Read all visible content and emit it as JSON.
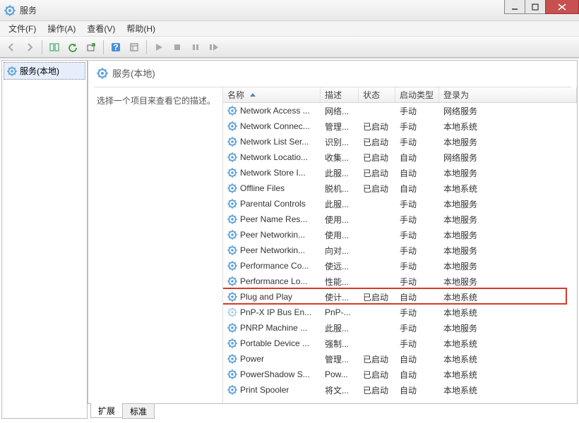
{
  "window": {
    "title": "服务"
  },
  "menu": {
    "file": "文件(F)",
    "action": "操作(A)",
    "view": "查看(V)",
    "help": "帮助(H)"
  },
  "tree": {
    "root_label": "服务(本地)"
  },
  "detail": {
    "header": "服务(本地)",
    "desc_prompt": "选择一个项目来查看它的描述。"
  },
  "columns": {
    "name": "名称",
    "desc": "描述",
    "status": "状态",
    "start": "启动类型",
    "logon": "登录为"
  },
  "tabs": {
    "extended": "扩展",
    "standard": "标准"
  },
  "services": [
    {
      "name": "Network Access ...",
      "desc": "网络...",
      "status": "",
      "start": "手动",
      "logon": "网络服务",
      "dim": false
    },
    {
      "name": "Network Connec...",
      "desc": "管理...",
      "status": "已启动",
      "start": "手动",
      "logon": "本地系统",
      "dim": false
    },
    {
      "name": "Network List Ser...",
      "desc": "识别...",
      "status": "已启动",
      "start": "手动",
      "logon": "本地服务",
      "dim": false
    },
    {
      "name": "Network Locatio...",
      "desc": "收集...",
      "status": "已启动",
      "start": "自动",
      "logon": "网络服务",
      "dim": false
    },
    {
      "name": "Network Store I...",
      "desc": "此服...",
      "status": "已启动",
      "start": "自动",
      "logon": "本地服务",
      "dim": false
    },
    {
      "name": "Offline Files",
      "desc": "脱机...",
      "status": "已启动",
      "start": "自动",
      "logon": "本地系统",
      "dim": false
    },
    {
      "name": "Parental Controls",
      "desc": "此服...",
      "status": "",
      "start": "手动",
      "logon": "本地服务",
      "dim": false
    },
    {
      "name": "Peer Name Res...",
      "desc": "使用...",
      "status": "",
      "start": "手动",
      "logon": "本地服务",
      "dim": false
    },
    {
      "name": "Peer Networkin...",
      "desc": "使用...",
      "status": "",
      "start": "手动",
      "logon": "本地服务",
      "dim": false
    },
    {
      "name": "Peer Networkin...",
      "desc": "向对...",
      "status": "",
      "start": "手动",
      "logon": "本地服务",
      "dim": false
    },
    {
      "name": "Performance Co...",
      "desc": "使远...",
      "status": "",
      "start": "手动",
      "logon": "本地服务",
      "dim": false
    },
    {
      "name": "Performance Lo...",
      "desc": "性能...",
      "status": "",
      "start": "手动",
      "logon": "本地服务",
      "dim": false
    },
    {
      "name": "Plug and Play",
      "desc": "使计...",
      "status": "已启动",
      "start": "自动",
      "logon": "本地系统",
      "dim": false,
      "highlight": true
    },
    {
      "name": "PnP-X IP Bus En...",
      "desc": "PnP-...",
      "status": "",
      "start": "手动",
      "logon": "本地系统",
      "dim": true
    },
    {
      "name": "PNRP Machine ...",
      "desc": "此服...",
      "status": "",
      "start": "手动",
      "logon": "本地服务",
      "dim": false
    },
    {
      "name": "Portable Device ...",
      "desc": "强制...",
      "status": "",
      "start": "手动",
      "logon": "本地系统",
      "dim": false
    },
    {
      "name": "Power",
      "desc": "管理...",
      "status": "已启动",
      "start": "自动",
      "logon": "本地系统",
      "dim": false
    },
    {
      "name": "PowerShadow S...",
      "desc": "Pow...",
      "status": "已启动",
      "start": "自动",
      "logon": "本地系统",
      "dim": false
    },
    {
      "name": "Print Spooler",
      "desc": "将文...",
      "status": "已启动",
      "start": "自动",
      "logon": "本地系统",
      "dim": false
    }
  ]
}
